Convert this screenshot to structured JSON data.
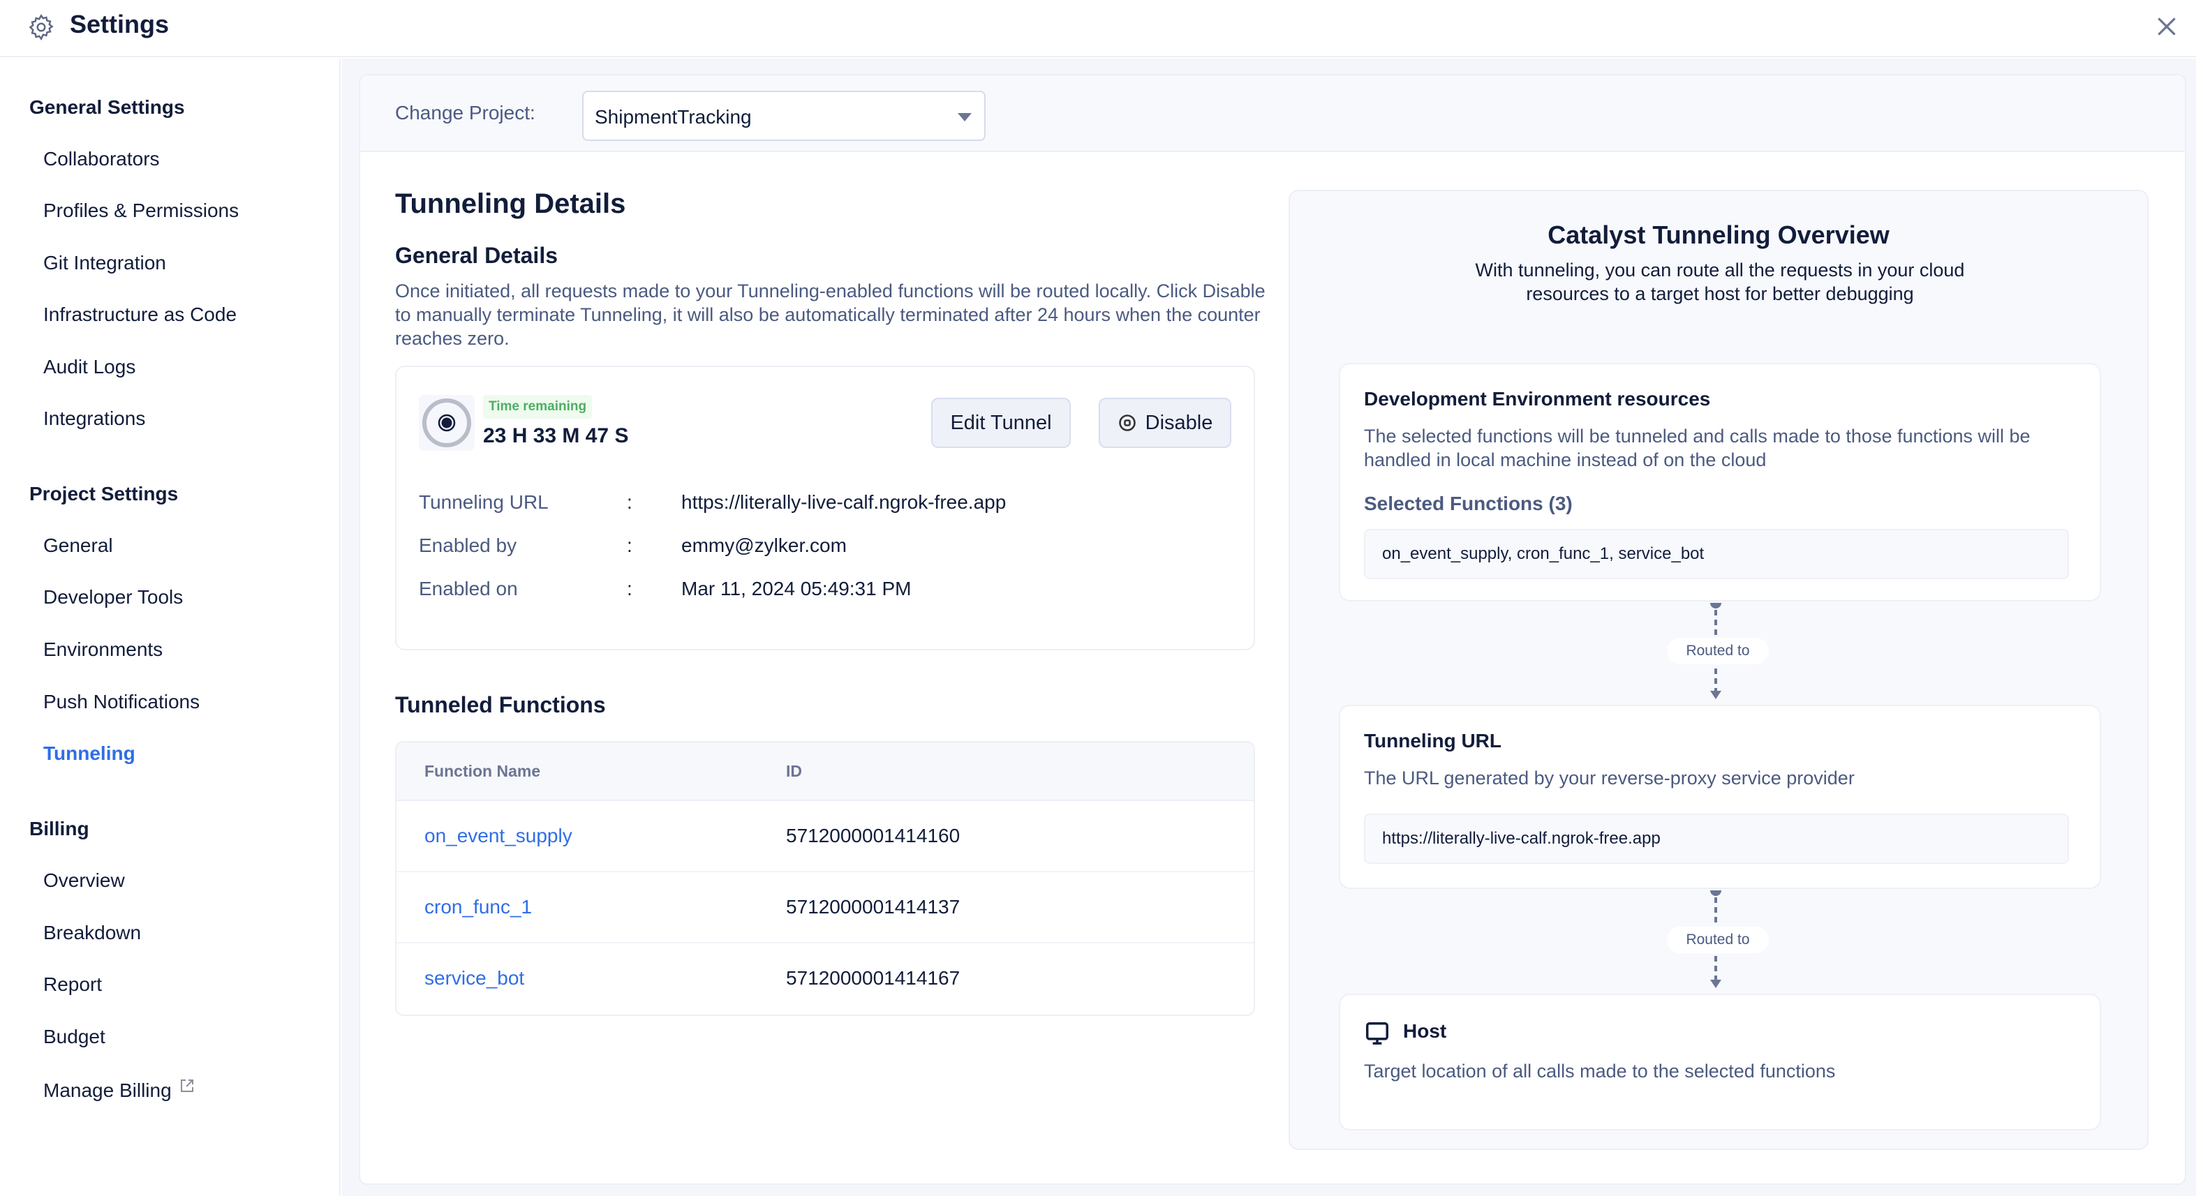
{
  "header": {
    "title": "Settings",
    "icon": "gear-icon",
    "close_icon": "close-icon"
  },
  "sidebar": {
    "sections": [
      {
        "title": "General Settings",
        "items": [
          "Collaborators",
          "Profiles & Permissions",
          "Git Integration",
          "Infrastructure as Code",
          "Audit Logs",
          "Integrations"
        ]
      },
      {
        "title": "Project Settings",
        "items": [
          "General",
          "Developer Tools",
          "Environments",
          "Push Notifications",
          "Tunneling"
        ]
      },
      {
        "title": "Billing",
        "items": [
          "Overview",
          "Breakdown",
          "Report",
          "Budget",
          "Manage Billing"
        ]
      }
    ],
    "active_item": "Tunneling",
    "accent_color": "#2f6ee6"
  },
  "project": {
    "label": "Change Project:",
    "selected": "ShipmentTracking"
  },
  "details": {
    "title": "Tunneling Details",
    "subtitle": "General Details",
    "description": "Once initiated, all requests made to your Tunneling-enabled functions will be routed locally. Click Disable to manually terminate Tunneling, it will also be automatically terminated after 24 hours when the counter reaches zero.",
    "timer": {
      "badge": "Time remaining",
      "value": "23 H 33 M 47 S"
    },
    "buttons": {
      "edit": "Edit Tunnel",
      "disable": "Disable"
    },
    "fields": [
      {
        "label": "Tunneling URL",
        "separator": ":",
        "value": "https://literally-live-calf.ngrok-free.app"
      },
      {
        "label": "Enabled by",
        "separator": ":",
        "value": "emmy@zylker.com"
      },
      {
        "label": "Enabled on",
        "separator": ":",
        "value": "Mar 11, 2024 05:49:31 PM"
      }
    ]
  },
  "functions": {
    "title": "Tunneled Functions",
    "columns": [
      "Function Name",
      "ID"
    ],
    "rows": [
      {
        "name": "on_event_supply",
        "id": "5712000001414160"
      },
      {
        "name": "cron_func_1",
        "id": "5712000001414137"
      },
      {
        "name": "service_bot",
        "id": "5712000001414167"
      }
    ]
  },
  "overview": {
    "title": "Catalyst Tunneling Overview",
    "subtitle": "With tunneling, you can route all the requests in your cloud resources to a target host for better debugging",
    "routed_label": "Routed to",
    "dev_card": {
      "title": "Development Environment resources",
      "description": "The selected functions will be tunneled and calls made to those functions will be handled in local machine instead of on the cloud",
      "selected_label": "Selected Functions",
      "selected_count": "(3)",
      "selected_value": "on_event_supply, cron_func_1, service_bot"
    },
    "url_card": {
      "title": "Tunneling URL",
      "description": "The URL generated by your reverse-proxy service provider",
      "value": "https://literally-live-calf.ngrok-free.app"
    },
    "host_card": {
      "title": "Host",
      "icon": "monitor-icon",
      "description": "Target location of all calls made to the selected functions"
    }
  }
}
